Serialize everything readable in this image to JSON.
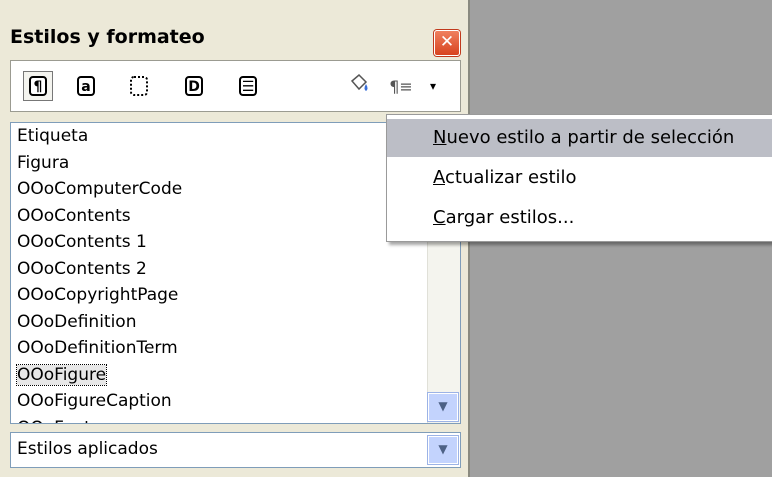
{
  "panel": {
    "title": "Estilos y formateo",
    "close_glyph": "✕",
    "toolbar": {
      "icons": [
        "paragraph-styles-icon",
        "character-styles-icon",
        "frame-styles-icon",
        "page-styles-icon",
        "list-styles-icon",
        "fill-format-icon",
        "new-style-menu-icon"
      ],
      "paragraph_glyph": "¶",
      "character_glyph": "a",
      "page_glyph": "D",
      "list_glyph": "☰",
      "fill_glyph": "🪣",
      "para_menu_glyph": "¶≡",
      "dropdown_glyph": "▾"
    },
    "styles": [
      "Etiqueta",
      "Figura",
      "OOoComputerCode",
      "OOoContents",
      "OOoContents 1",
      "OOoContents 2",
      "OOoCopyrightPage",
      "OOoDefinition",
      "OOoDefinitionTerm",
      "OOoFigure",
      "OOoFigureCaption",
      "OOoFooter"
    ],
    "selected_style": "OOoFigure",
    "filter": {
      "value": "Estilos aplicados",
      "arrow": "▼"
    },
    "scroll_arrow": "▼"
  },
  "menu": {
    "items": [
      {
        "first": "N",
        "rest": "uevo estilo a partir de selección"
      },
      {
        "first": "A",
        "rest": "ctualizar estilo"
      },
      {
        "first": "C",
        "rest": "argar estilos..."
      }
    ],
    "highlighted_index": 0
  }
}
